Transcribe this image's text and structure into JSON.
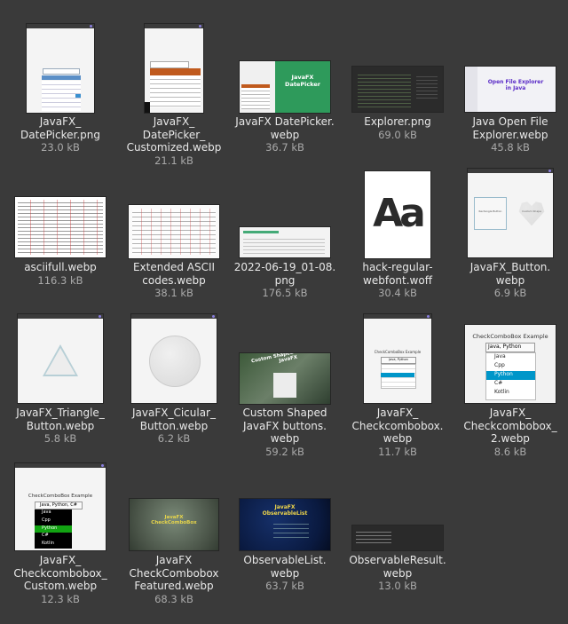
{
  "files": [
    {
      "name": "JavaFX_\nDatePicker.png",
      "size": "23.0 kB"
    },
    {
      "name": "JavaFX_\nDatePicker_\nCustomized.webp",
      "size": "21.1 kB"
    },
    {
      "name": "JavaFX DatePicker.\nwebp",
      "size": "36.7 kB"
    },
    {
      "name": "Explorer.png",
      "size": "69.0 kB"
    },
    {
      "name": "Java Open File\nExplorer.webp",
      "size": "45.8 kB"
    },
    {
      "name": "asciifull.webp",
      "size": "116.3 kB"
    },
    {
      "name": "Extended ASCII\ncodes.webp",
      "size": "38.1 kB"
    },
    {
      "name": "2022-06-19_01-08.\npng",
      "size": "176.5 kB"
    },
    {
      "name": "hack-regular-\nwebfont.woff",
      "size": "30.4 kB"
    },
    {
      "name": "JavaFX_Button.\nwebp",
      "size": "6.9 kB"
    },
    {
      "name": "JavaFX_Triangle_\nButton.webp",
      "size": "5.8 kB"
    },
    {
      "name": "JavaFX_Cicular_\nButton.webp",
      "size": "6.2 kB"
    },
    {
      "name": "Custom Shaped\nJavaFX buttons.\nwebp",
      "size": "59.2 kB"
    },
    {
      "name": "JavaFX_\nCheckcombobox.\nwebp",
      "size": "11.7 kB"
    },
    {
      "name": "JavaFX_\nCheckcombobox_\n2.webp",
      "size": "8.6 kB"
    },
    {
      "name": "JavaFX_\nCheckcombobox_\nCustom.webp",
      "size": "12.3 kB"
    },
    {
      "name": "JavaFX\nCheckCombobox\nFeatured.webp",
      "size": "68.3 kB"
    },
    {
      "name": "ObservableList.\nwebp",
      "size": "63.7 kB"
    },
    {
      "name": "ObservableResult.\nwebp",
      "size": "13.0 kB"
    }
  ],
  "thumbs": {
    "datepicker_banner_title": "JavaFX DatePicker",
    "explorer_title": "Open File Explorer\nin Java",
    "font_glyph": "Aa",
    "button_left": "Rectangle Button",
    "button_right": "Custom Shape",
    "custom_shaped_title": "Custom Shaped Buttons in JavaFX",
    "checkcombo_title": "CheckComboBox Example",
    "checkcombo_value": "Java, Python",
    "checkcombo_custom_value": "Java, Python, C#",
    "checkcombo_options": [
      "Java",
      "Cpp",
      "Python",
      "C#",
      "Kotlin"
    ],
    "featured_title": "JavaFX\nCheckComboBox",
    "observable_title": "JavaFX\nObservableList"
  },
  "colors": {
    "background": "#3a3a3a",
    "label": "#e8e8e8",
    "size": "#a9a9a9",
    "selection_blue": "#0096c9",
    "font_red": "#d23b3b",
    "datepicker_green": "#2e9a5b",
    "datepicker_header": "#c05a1d"
  }
}
